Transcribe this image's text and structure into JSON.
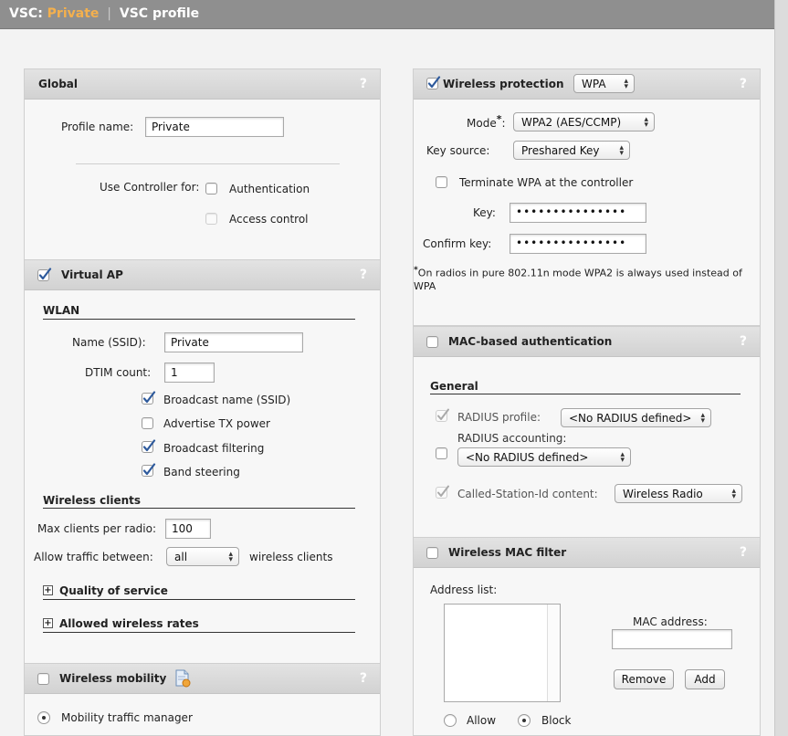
{
  "header": {
    "vsc": "VSC:",
    "profile_name": "Private",
    "separator": "|",
    "section": "VSC profile"
  },
  "help": "?",
  "global": {
    "title": "Global",
    "profile_name_label": "Profile name:",
    "profile_name_value": "Private",
    "use_controller_label": "Use Controller for:",
    "authentication": "Authentication",
    "access_control": "Access control"
  },
  "virtual_ap": {
    "title": "Virtual AP",
    "wlan_heading": "WLAN",
    "ssid_label": "Name (SSID):",
    "ssid_value": "Private",
    "dtim_label": "DTIM count:",
    "dtim_value": "1",
    "broadcast_name": "Broadcast name (SSID)",
    "advertise_tx": "Advertise TX power",
    "broadcast_filtering": "Broadcast filtering",
    "band_steering": "Band steering",
    "clients_heading": "Wireless clients",
    "max_clients_label": "Max clients per radio:",
    "max_clients_value": "100",
    "allow_traffic_label": "Allow traffic between:",
    "allow_traffic_value": "all",
    "wireless_clients": "wireless clients",
    "qos": "Quality of service",
    "allowed_rates": "Allowed wireless rates"
  },
  "mobility": {
    "title": "Wireless mobility",
    "traffic_manager": "Mobility traffic manager"
  },
  "protection": {
    "title": "Wireless protection",
    "type_value": "WPA",
    "mode_label": "Mode",
    "mode_star": "*",
    "mode_suffix": ":",
    "mode_value": "WPA2 (AES/CCMP)",
    "key_source_label": "Key source:",
    "key_source_value": "Preshared Key",
    "terminate": "Terminate WPA at the controller",
    "key_label": "Key:",
    "key_value": "•••••••••••••••",
    "confirm_label": "Confirm key:",
    "confirm_value": "•••••••••••••••",
    "note_star": "*",
    "note": "On radios in pure 802.11n mode WPA2 is always used instead of WPA"
  },
  "mac_auth": {
    "title": "MAC-based authentication",
    "general": "General",
    "radius_profile_label": "RADIUS profile:",
    "radius_profile_value": "<No RADIUS defined>",
    "radius_accounting_label": "RADIUS accounting:",
    "radius_accounting_value": "<No RADIUS defined>",
    "called_station_label": "Called-Station-Id content:",
    "called_station_value": "Wireless Radio"
  },
  "mac_filter": {
    "title": "Wireless MAC filter",
    "address_list": "Address list:",
    "mac_address_label": "MAC address:",
    "remove": "Remove",
    "add": "Add",
    "allow": "Allow",
    "block": "Block"
  },
  "colors": {
    "accent": "#f4b04d",
    "header_bar": "#8f8f8f",
    "panel_header": "#d9d9d9"
  }
}
